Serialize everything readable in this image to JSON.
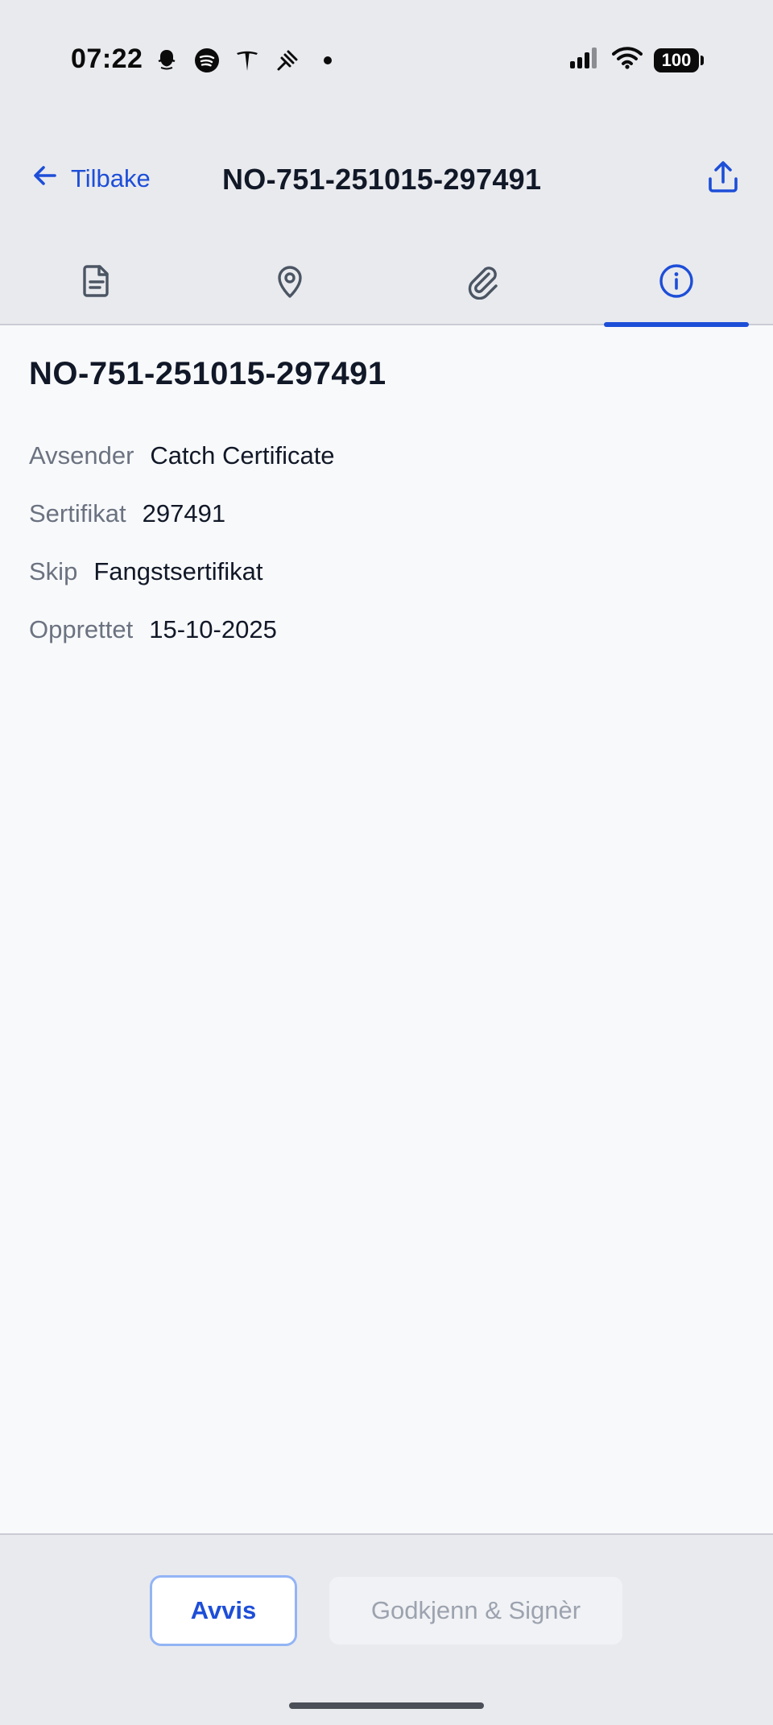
{
  "status_bar": {
    "time": "07:22",
    "app_icons": [
      "snapchat-icon",
      "spotify-icon",
      "tesla-icon",
      "satellite-icon",
      "dot-icon"
    ],
    "signal_icon": "signal-bars-icon",
    "wifi_icon": "wifi-icon",
    "battery": "100"
  },
  "nav": {
    "back_label": "Tilbake",
    "title": "NO-751-251015-297491",
    "share_icon": "share-icon"
  },
  "tabs": [
    {
      "icon": "document-icon",
      "active": false
    },
    {
      "icon": "location-pin-icon",
      "active": false
    },
    {
      "icon": "paperclip-icon",
      "active": false
    },
    {
      "icon": "info-icon",
      "active": true
    }
  ],
  "details": {
    "title": "NO-751-251015-297491",
    "fields": [
      {
        "label": "Avsender",
        "value": "Catch Certificate"
      },
      {
        "label": "Sertifikat",
        "value": "297491"
      },
      {
        "label": "Skip",
        "value": "Fangstsertifikat"
      },
      {
        "label": "Opprettet",
        "value": "15-10-2025"
      }
    ]
  },
  "actions": {
    "reject_label": "Avvis",
    "approve_label": "Godkjenn & Signèr"
  },
  "colors": {
    "accent": "#1d4ed8",
    "header_bg": "#e9eaee",
    "content_bg": "#f8f9fb",
    "label_text": "#6b7280"
  }
}
